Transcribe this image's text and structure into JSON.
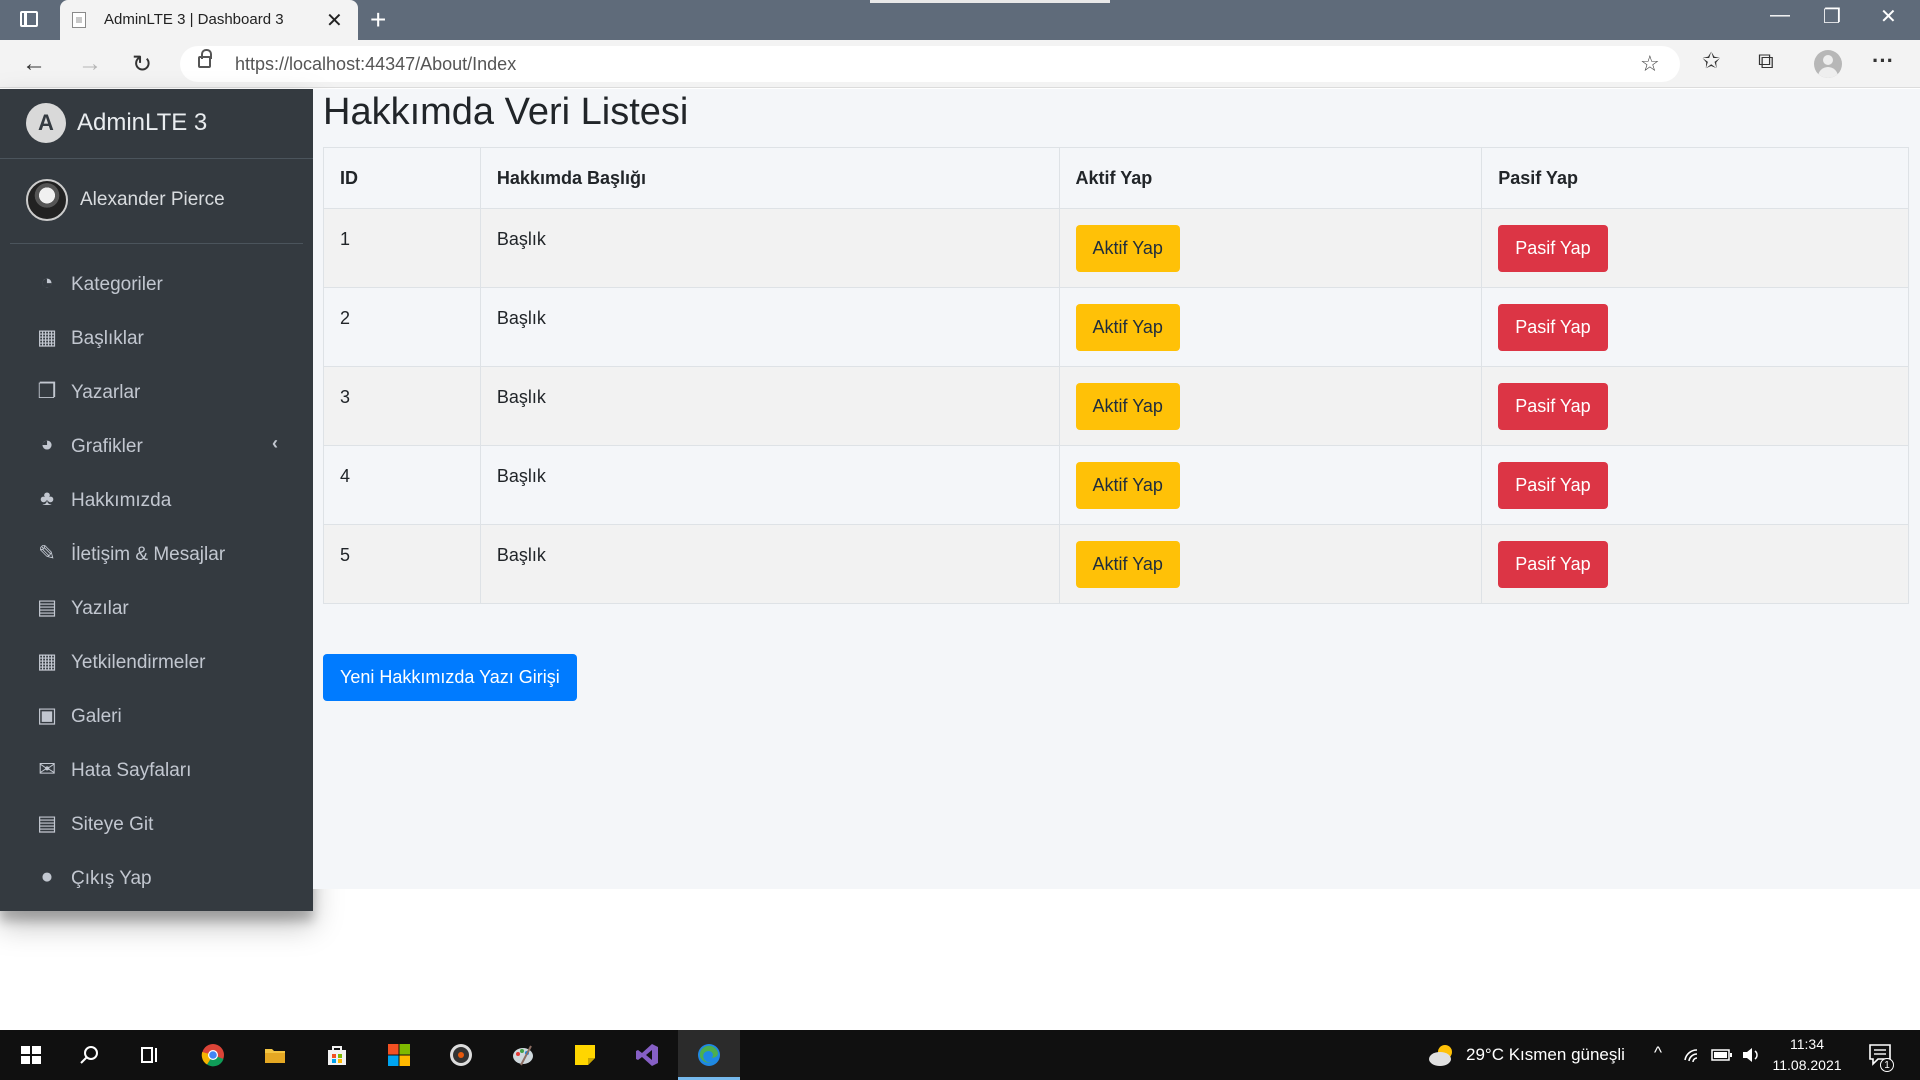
{
  "browser": {
    "tab_title": "AdminLTE 3 | Dashboard 3",
    "new_tab_glyph": "+",
    "tab_close_glyph": "✕",
    "url": "https://localhost:44347/About/Index",
    "window_controls": {
      "minimize": "—",
      "restore": "❐",
      "close": "✕"
    }
  },
  "sidebar": {
    "brand": "AdminLTE 3",
    "brand_logo_letter": "A",
    "user_name": "Alexander Pierce",
    "items": [
      {
        "label": "Kategoriler",
        "icon": "tachometer-icon",
        "glyph": "◔"
      },
      {
        "label": "Başlıklar",
        "icon": "grid-icon",
        "glyph": "▦"
      },
      {
        "label": "Yazarlar",
        "icon": "copy-icon",
        "glyph": "❐"
      },
      {
        "label": "Grafikler",
        "icon": "pie-chart-icon",
        "glyph": "◕",
        "chevron": "‹"
      },
      {
        "label": "Hakkımızda",
        "icon": "tree-icon",
        "glyph": "♣"
      },
      {
        "label": "İletişim & Mesajlar",
        "icon": "edit-icon",
        "glyph": "✎"
      },
      {
        "label": "Yazılar",
        "icon": "table-icon",
        "glyph": "▤"
      },
      {
        "label": "Yetkilendirmeler",
        "icon": "calendar-icon",
        "glyph": "▦"
      },
      {
        "label": "Galeri",
        "icon": "image-icon",
        "glyph": "▣"
      },
      {
        "label": "Hata Sayfaları",
        "icon": "envelope-icon",
        "glyph": "✉"
      },
      {
        "label": "Siteye Git",
        "icon": "book-icon",
        "glyph": "▤"
      },
      {
        "label": "Çıkış Yap",
        "icon": "apple-icon",
        "glyph": "●"
      }
    ]
  },
  "content": {
    "title": "Hakkımda Veri Listesi",
    "table": {
      "headers": [
        "ID",
        "Hakkımda Başlığı",
        "Aktif Yap",
        "Pasif Yap"
      ],
      "rows": [
        {
          "id": "1",
          "title": "Başlık",
          "active_label": "Aktif Yap",
          "passive_label": "Pasif Yap"
        },
        {
          "id": "2",
          "title": "Başlık",
          "active_label": "Aktif Yap",
          "passive_label": "Pasif Yap"
        },
        {
          "id": "3",
          "title": "Başlık",
          "active_label": "Aktif Yap",
          "passive_label": "Pasif Yap"
        },
        {
          "id": "4",
          "title": "Başlık",
          "active_label": "Aktif Yap",
          "passive_label": "Pasif Yap"
        },
        {
          "id": "5",
          "title": "Başlık",
          "active_label": "Aktif Yap",
          "passive_label": "Pasif Yap"
        }
      ]
    },
    "new_button": "Yeni Hakkımızda Yazı Girişi"
  },
  "taskbar": {
    "weather": "29°C  Kısmen güneşli",
    "time": "11:34",
    "date": "11.08.2021",
    "notification_count": "1"
  },
  "colors": {
    "sidebar_bg": "#343a40",
    "content_bg": "#f4f6f9",
    "warning": "#ffc107",
    "danger": "#dc3545",
    "primary": "#007bff"
  }
}
